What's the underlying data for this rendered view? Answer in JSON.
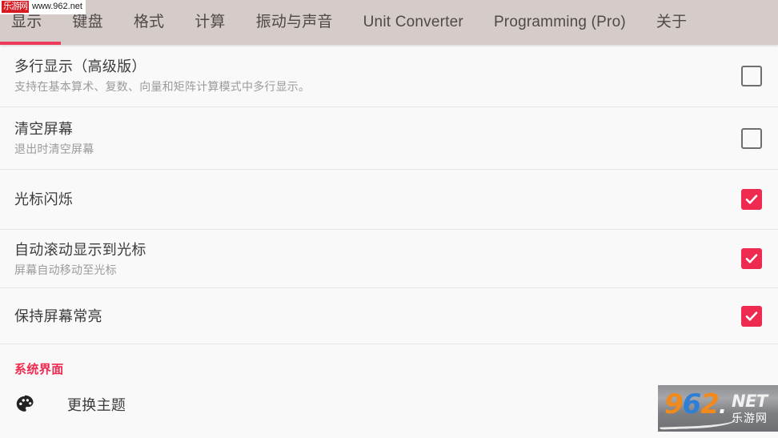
{
  "watermark_top": {
    "badge": "乐游网",
    "url": "www.962.net"
  },
  "watermark_logo": {
    "d9": "9",
    "d6": "6",
    "d2": "2",
    "dot": ".",
    "net": "NET",
    "cn": "乐游网"
  },
  "tabs": [
    {
      "label": "显示",
      "active": true
    },
    {
      "label": "键盘",
      "active": false
    },
    {
      "label": "格式",
      "active": false
    },
    {
      "label": "计算",
      "active": false
    },
    {
      "label": "振动与声音",
      "active": false
    },
    {
      "label": "Unit Converter",
      "active": false
    },
    {
      "label": "Programming (Pro)",
      "active": false
    },
    {
      "label": "关于",
      "active": false
    }
  ],
  "settings": [
    {
      "title": "多行显示（高级版）",
      "subtitle": "支持在基本算术、复数、向量和矩阵计算模式中多行显示。",
      "checked": false
    },
    {
      "title": "清空屏幕",
      "subtitle": "退出时清空屏幕",
      "checked": false
    },
    {
      "title": "光标闪烁",
      "subtitle": "",
      "checked": true
    },
    {
      "title": "自动滚动显示到光标",
      "subtitle": "屏幕自动移动至光标",
      "checked": true
    },
    {
      "title": "保持屏幕常亮",
      "subtitle": "",
      "checked": true
    }
  ],
  "section": {
    "header": "系统界面",
    "theme_label": "更换主题",
    "theme_icon": "palette-icon"
  },
  "colors": {
    "accent_red": "#ee2a50",
    "tabbar_bg": "#d5cbc8",
    "content_bg": "#f9f9f9",
    "title_text": "#3b3b3b",
    "sub_text": "#9b9b9b",
    "tab_text": "#4e4a49"
  }
}
